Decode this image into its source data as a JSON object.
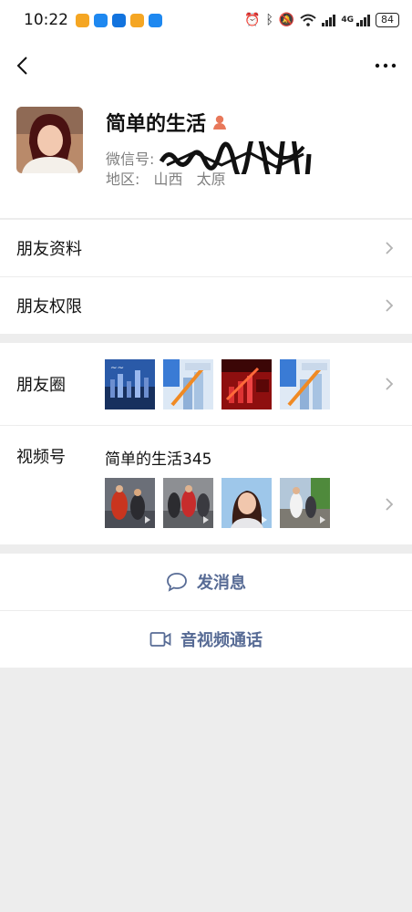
{
  "status_bar": {
    "time": "10:22",
    "network": "4G",
    "battery": "84"
  },
  "profile": {
    "name": "简单的生活",
    "wechat_id_label": "微信号:",
    "region_label": "地区:",
    "region_province": "山西",
    "region_city": "太原"
  },
  "menu": {
    "friend_info": "朋友资料",
    "friend_permission": "朋友权限",
    "moments": "朋友圈",
    "channels": "视频号",
    "channel_name": "简单的生活345"
  },
  "actions": {
    "send_message": "发消息",
    "av_call": "音视频通话"
  },
  "colors": {
    "link": "#576b95",
    "background": "#ededed",
    "gender_female": "#e8785a"
  }
}
